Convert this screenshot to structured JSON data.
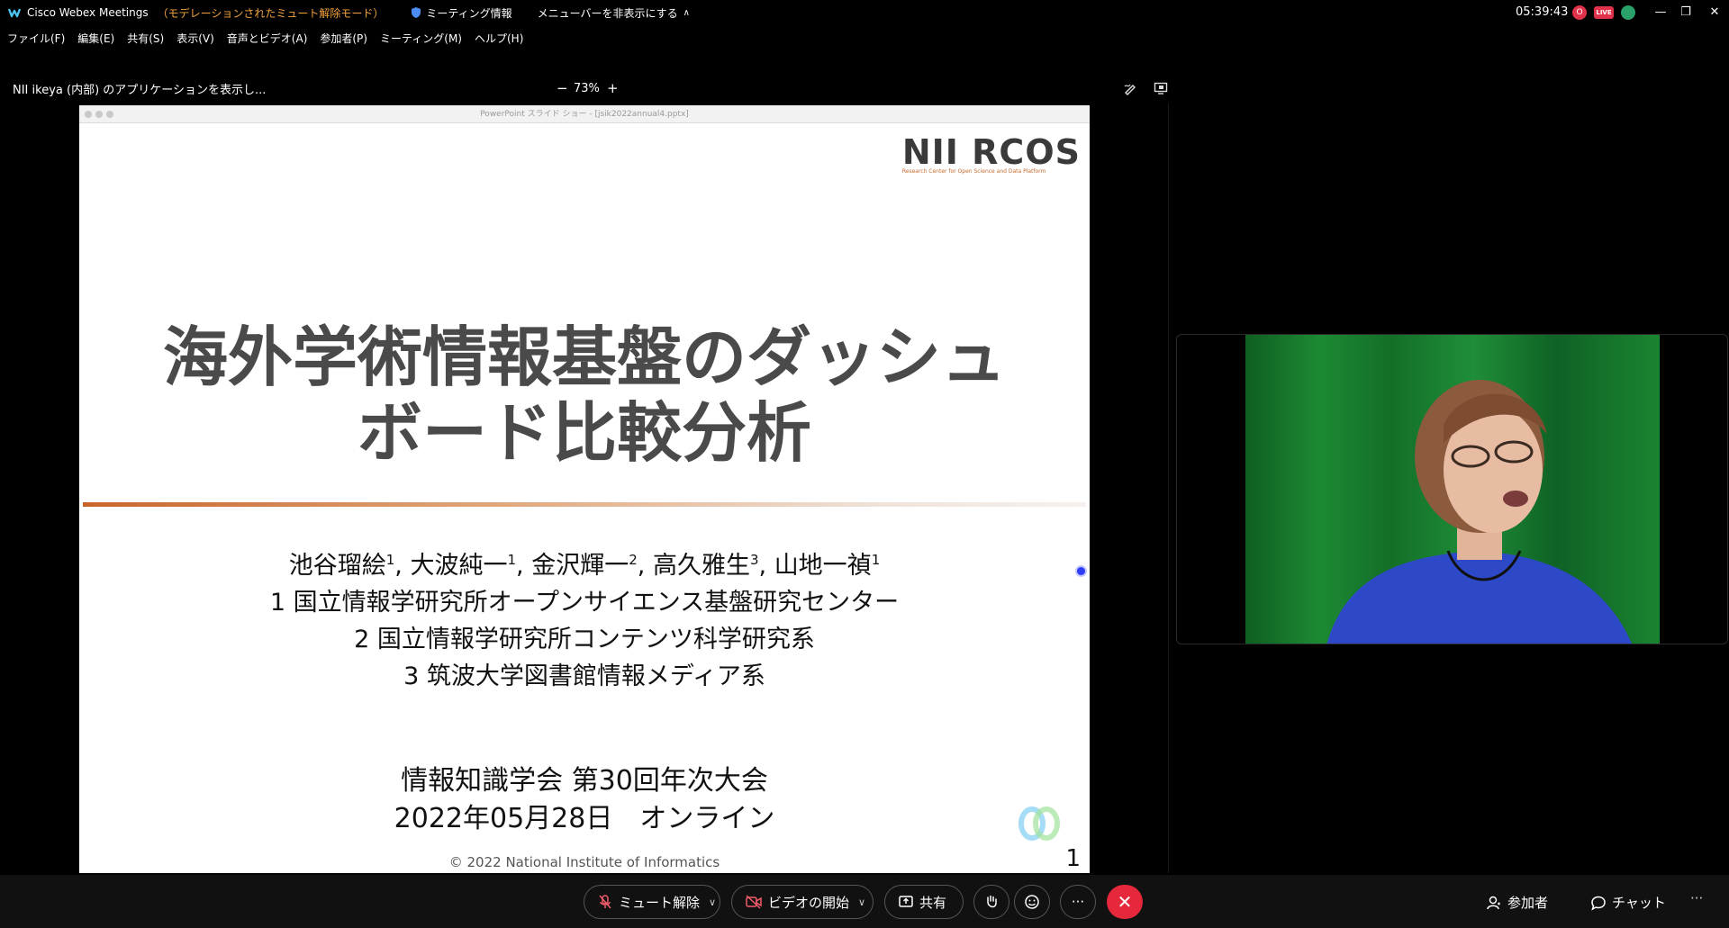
{
  "titlebar": {
    "app_name": "Cisco Webex Meetings",
    "mode": "（モデレーションされたミュート解除モード）",
    "meeting_info": "ミーティング情報",
    "hide_menu": "メニューバーを非表示にする",
    "clock": "05:39:43",
    "rec_label": "O",
    "live_label": "LIVE"
  },
  "menubar": {
    "items": [
      "ファイル(F)",
      "編集(E)",
      "共有(S)",
      "表示(V)",
      "音声とビデオ(A)",
      "参加者(P)",
      "ミーティング(M)",
      "ヘルプ(H)"
    ]
  },
  "sharebar": {
    "title": "NII ikeya (内部) のアプリケーションを表示し...",
    "zoom_minus": "−",
    "zoom_level": "73%",
    "zoom_plus": "+"
  },
  "ppt": {
    "window_title": "PowerPoint スライド ショー - [jsik2022annual4.pptx]"
  },
  "slide": {
    "logo_main": "NII RCOS",
    "logo_sub": "Research Center for Open Science and Data Platform",
    "title_line1": "海外学術情報基盤のダッシュ",
    "title_line2": "ボード比較分析",
    "authors": [
      {
        "name": "池谷瑠絵",
        "sup": "1"
      },
      {
        "name": "大波純一",
        "sup": "1"
      },
      {
        "name": "金沢輝一",
        "sup": "2"
      },
      {
        "name": "高久雅生",
        "sup": "3"
      },
      {
        "name": "山地一禎",
        "sup": "1"
      }
    ],
    "separator": ",",
    "affiliation1": "1 国立情報学研究所オープンサイエンス基盤研究センター",
    "affiliation2": "2 国立情報学研究所コンテンツ科学研究系",
    "affiliation3": "3 筑波大学図書館情報メディア系",
    "conference": "情報知識学会 第30回年次大会",
    "date": "2022年05月28日　オンライン",
    "copyright": "© 2022 National Institute of Informatics",
    "page_number": "1"
  },
  "controls": {
    "unmute": "ミュート解除",
    "start_video": "ビデオの開始",
    "share": "共有",
    "more": "···",
    "participants": "参加者",
    "chat": "チャット",
    "overflow": "···"
  },
  "colors": {
    "accent_orange": "#f4a23c",
    "end_red": "#e5283b",
    "slide_rule": "#c8642a"
  }
}
